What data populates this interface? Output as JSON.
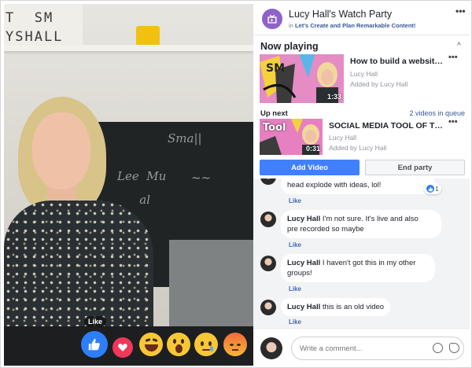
{
  "video": {
    "lightbox_text": "T  SM\nYSHALL",
    "like_tooltip": "Like",
    "reactions": [
      "like-reaction",
      "love-reaction",
      "haha-reaction",
      "wow-reaction",
      "sad-reaction",
      "angry-reaction"
    ]
  },
  "header": {
    "title": "Lucy Hall's Watch Party",
    "group_prefix": "in",
    "group_name": "Let's Create and Plan Remarkable Content!",
    "more": "•••"
  },
  "now_playing": {
    "heading": "Now playing",
    "video": {
      "title": "How to build a website...",
      "channel": "Lucy Hall",
      "added_by": "Added by Lucy Hall",
      "duration": "1:33",
      "more": "•••"
    }
  },
  "up_next": {
    "heading": "Up next",
    "queue_link": "2 videos in queue",
    "video": {
      "title": "SOCIAL MEDIA TOOL OF TH...",
      "channel": "Lucy Hall",
      "added_by": "Added by Lucy Hall",
      "duration": "0:31",
      "thumb_text": "Tool",
      "more": "•••"
    }
  },
  "buttons": {
    "add_video": "Add Video",
    "end_party": "End party"
  },
  "comments": [
    {
      "author": "",
      "text": "head explode with ideas, lol!",
      "like": "Like",
      "reaction_count": "1"
    },
    {
      "author": "Lucy Hall",
      "text": "I'm not sure. It's live and also",
      "text2": "pre recorded so maybe",
      "like": "Like"
    },
    {
      "author": "Lucy Hall",
      "text": "I haven't got this in my other",
      "text2": "groups!",
      "like": "Like"
    },
    {
      "author": "Lucy Hall",
      "text": "this is an old video",
      "like": "Like"
    }
  ],
  "composer": {
    "placeholder": "Write a comment..."
  }
}
